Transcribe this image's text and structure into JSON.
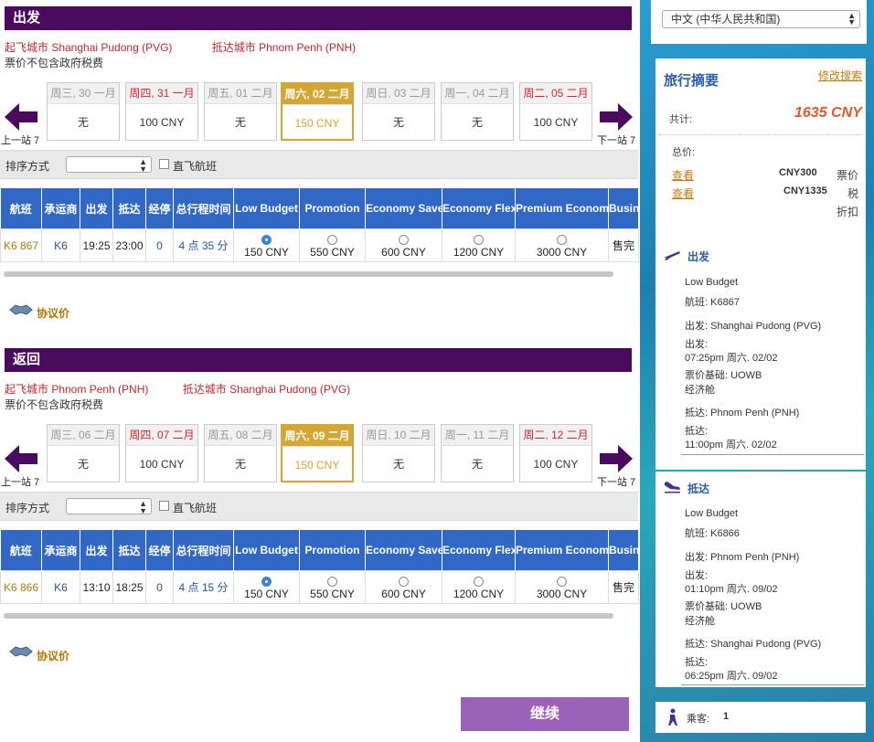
{
  "outbound": {
    "title": "出发",
    "from_label": "起飞城市 Shanghai Pudong (PVG)",
    "to_label": "抵达城市 Phnom Penh (PNH)",
    "tax_note": "票价不包含政府税费",
    "dates": [
      {
        "header": "周三, 30 一月",
        "value": "无",
        "red": false,
        "selected": false
      },
      {
        "header": "周四, 31 一月",
        "value": "100 CNY",
        "red": true,
        "selected": false
      },
      {
        "header": "周五, 01 二月",
        "value": "无",
        "red": false,
        "selected": false
      },
      {
        "header": "周六, 02 二月",
        "value": "150 CNY",
        "red": false,
        "selected": true
      },
      {
        "header": "周日, 03 二月",
        "value": "无",
        "red": false,
        "selected": false
      },
      {
        "header": "周一, 04 二月",
        "value": "无",
        "red": false,
        "selected": false
      },
      {
        "header": "周二, 05 二月",
        "value": "100 CNY",
        "red": true,
        "selected": false
      }
    ],
    "prev_label": "上一站 7",
    "next_label": "下一站 7",
    "sort_label": "排序方式",
    "direct_label": "直飞航班",
    "row": {
      "flight": "K6 867",
      "carrier": "K6",
      "dep": "19:25",
      "arr": "23:00",
      "stops": "0",
      "duration": "4 点 35 分",
      "fares": [
        "150 CNY",
        "550 CNY",
        "600 CNY",
        "1200 CNY",
        "3000 CNY"
      ],
      "last": "售完",
      "selected_fare": 0
    },
    "agreement": "协议价"
  },
  "return": {
    "title": "返回",
    "from_label": "起飞城市 Phnom Penh (PNH)",
    "to_label": "抵达城市 Shanghai Pudong (PVG)",
    "tax_note": "票价不包含政府税费",
    "dates": [
      {
        "header": "周三, 06 二月",
        "value": "无",
        "red": false,
        "selected": false
      },
      {
        "header": "周四, 07 二月",
        "value": "100 CNY",
        "red": true,
        "selected": false
      },
      {
        "header": "周五, 08 二月",
        "value": "无",
        "red": false,
        "selected": false
      },
      {
        "header": "周六, 09 二月",
        "value": "150 CNY",
        "red": false,
        "selected": true
      },
      {
        "header": "周日, 10 二月",
        "value": "无",
        "red": false,
        "selected": false
      },
      {
        "header": "周一, 11 二月",
        "value": "无",
        "red": false,
        "selected": false
      },
      {
        "header": "周二, 12 二月",
        "value": "100 CNY",
        "red": true,
        "selected": false
      }
    ],
    "prev_label": "上一站 7",
    "next_label": "下一站 7",
    "sort_label": "排序方式",
    "direct_label": "直飞航班",
    "row": {
      "flight": "K6 866",
      "carrier": "K6",
      "dep": "13:10",
      "arr": "18:25",
      "stops": "0",
      "duration": "4 点 15 分",
      "fares": [
        "150 CNY",
        "550 CNY",
        "600 CNY",
        "1200 CNY",
        "3000 CNY"
      ],
      "last": "售完",
      "selected_fare": 0
    },
    "agreement": "协议价"
  },
  "table_headers": [
    "航班",
    "承运商",
    "出发",
    "抵达",
    "经停",
    "总行程时间",
    "Low Budget",
    "Promotion",
    "Economy Saver",
    "Economy Flex",
    "Premium Economy",
    "Business"
  ],
  "continue_label": "继续",
  "sidebar": {
    "language": "中文 (中华人民共和国)",
    "summary_title": "旅行摘要",
    "modify_search": "修改搜索",
    "total_label": "共计:",
    "total_value": "1635 CNY",
    "total_price_label": "总价:",
    "view1": "查看",
    "amount1": "CNY300",
    "type1": "票价",
    "view2": "查看",
    "amount2": "CNY1335",
    "type2": "税",
    "discount": "折扣",
    "depart": {
      "title": "出发",
      "fare_type": "Low Budget",
      "flight": "航班:  K6867",
      "from": "出发:  Shanghai Pudong (PVG)",
      "dep_label": "出发:",
      "dep_time": "07:25pm 周六. 02/02",
      "fare_basis": "票价基础:  UOWB",
      "cabin": "经济舱",
      "to": "抵达:  Phnom Penh (PNH)",
      "arr_label": "抵达:",
      "arr_time": "11:00pm 周六. 02/02"
    },
    "arrive": {
      "title": "抵达",
      "fare_type": "Low Budget",
      "flight": "航班:  K6866",
      "from": "出发:  Phnom Penh (PNH)",
      "dep_label": "出发:",
      "dep_time": "01:10pm 周六. 09/02",
      "fare_basis": "票价基础:  UOWB",
      "cabin": "经济舱",
      "to": "抵达:  Shanghai Pudong (PVG)",
      "arr_label": "抵达:",
      "arr_time": "06:25pm 周六. 09/02"
    },
    "passengers_label": "乘客:",
    "passengers_value": "1"
  },
  "colors": {
    "header_purple": "#4a0a5e",
    "table_blue": "#3268c5",
    "selected_gold": "#d4a634",
    "accent_red": "#c0282e",
    "continue_purple": "#9a62b8",
    "total_orange": "#e2582a"
  }
}
